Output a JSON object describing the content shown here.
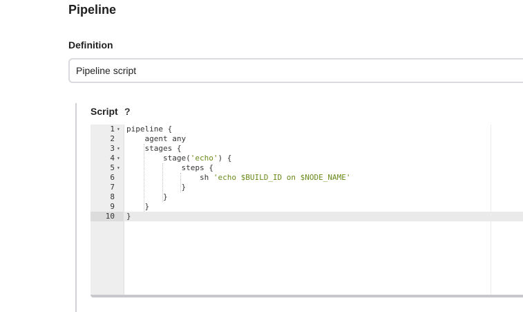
{
  "section": {
    "title": "Pipeline"
  },
  "definition": {
    "label": "Definition",
    "selected": "Pipeline script"
  },
  "script": {
    "label": "Script",
    "help": "?",
    "lines": [
      {
        "num": "1",
        "fold": "▾",
        "indent": "",
        "text": "pipeline ",
        "str": "",
        "tail": "{"
      },
      {
        "num": "2",
        "fold": "",
        "indent": "    ",
        "text": "agent any",
        "str": "",
        "tail": ""
      },
      {
        "num": "3",
        "fold": "▾",
        "indent": "    ",
        "text": "stages {",
        "str": "",
        "tail": ""
      },
      {
        "num": "4",
        "fold": "▾",
        "indent": "        ",
        "text": "stage(",
        "str": "'echo'",
        "tail": ") {"
      },
      {
        "num": "5",
        "fold": "▾",
        "indent": "            ",
        "text": "steps {",
        "str": "",
        "tail": ""
      },
      {
        "num": "6",
        "fold": "",
        "indent": "                ",
        "text": "sh ",
        "str": "'echo $BUILD_ID on $NODE_NAME'",
        "tail": ""
      },
      {
        "num": "7",
        "fold": "",
        "indent": "            ",
        "text": "}",
        "str": "",
        "tail": ""
      },
      {
        "num": "8",
        "fold": "",
        "indent": "        ",
        "text": "}",
        "str": "",
        "tail": ""
      },
      {
        "num": "9",
        "fold": "",
        "indent": "    ",
        "text": "}",
        "str": "",
        "tail": ""
      },
      {
        "num": "10",
        "fold": "",
        "indent": "",
        "text": "}",
        "str": "",
        "tail": ""
      }
    ]
  }
}
